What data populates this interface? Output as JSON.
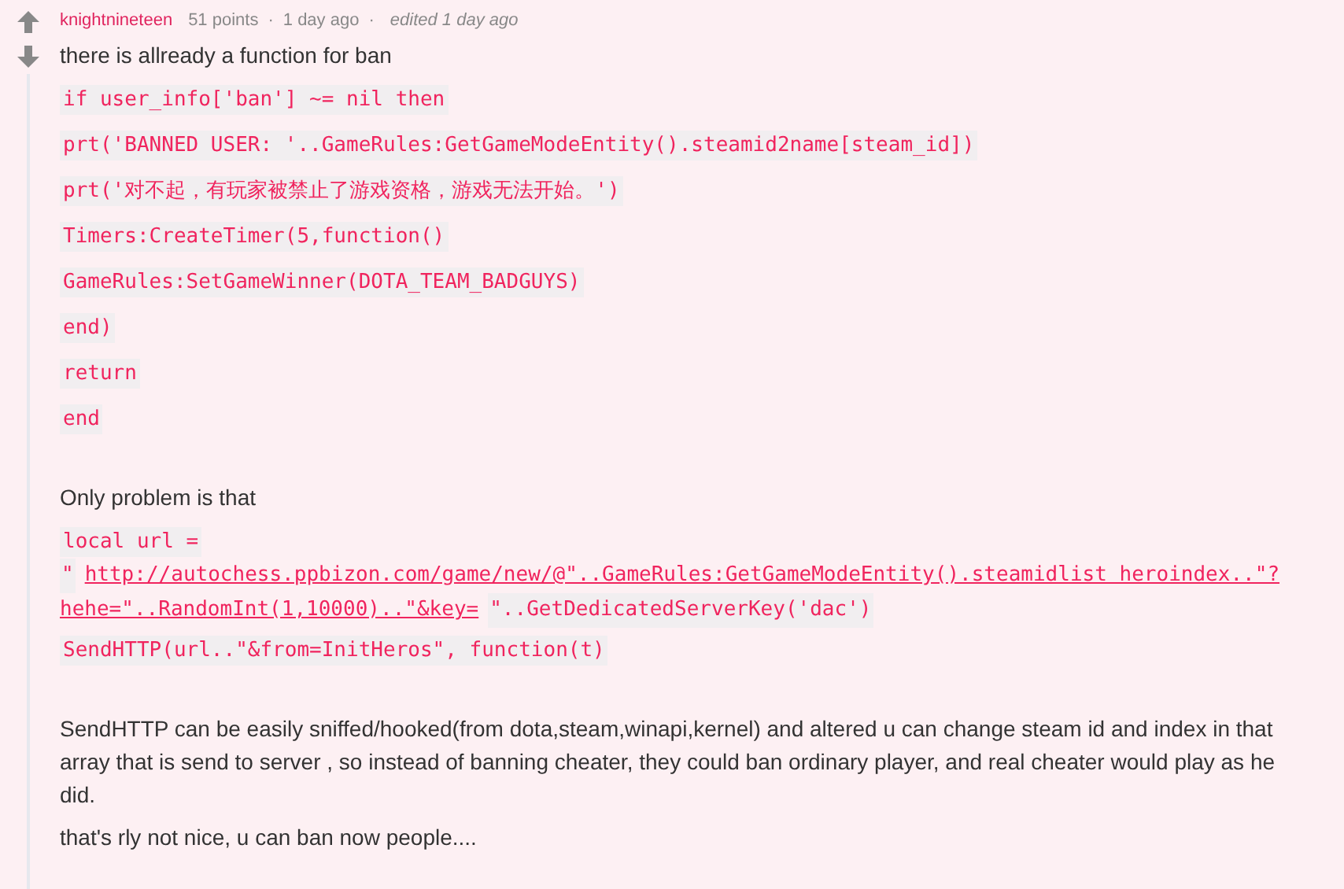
{
  "comment": {
    "author": "knightnineteen",
    "points": "51 points",
    "separator_1": "·",
    "time": "1 day ago",
    "separator_2": "·",
    "edited": "edited 1 day ago"
  },
  "blocks": [
    {
      "kind": "text",
      "text": "there is allready a function for ban"
    },
    {
      "kind": "code",
      "text": "if user_info['ban'] ~= nil then"
    },
    {
      "kind": "code",
      "text": "prt('BANNED USER: '..GameRules:GetGameModeEntity().steamid2name[steam_id])"
    },
    {
      "kind": "code",
      "text": "prt('对不起，有玩家被禁止了游戏资格，游戏无法开始。')"
    },
    {
      "kind": "code",
      "text": "Timers:CreateTimer(5,function()"
    },
    {
      "kind": "code",
      "text": "GameRules:SetGameWinner(DOTA_TEAM_BADGUYS)"
    },
    {
      "kind": "code",
      "text": "end)"
    },
    {
      "kind": "code",
      "text": "return"
    },
    {
      "kind": "code",
      "text": "end"
    },
    {
      "kind": "gap"
    },
    {
      "kind": "text",
      "text": "Only problem is that"
    },
    {
      "kind": "code",
      "text": "local url ="
    },
    {
      "kind": "mixed",
      "lines": [
        [
          {
            "kind": "code",
            "text": "\""
          },
          {
            "kind": "link",
            "text": "http://autochess.ppbizon.com/game/new/@\"..GameRules:GetGameModeEntity().steamidlist heroindex..\"?"
          }
        ],
        [
          {
            "kind": "link",
            "text": "hehe=\"..RandomInt(1,10000)..\"&key="
          },
          {
            "kind": "code",
            "text": "\"..GetDedicatedServerKey('dac')"
          }
        ]
      ]
    },
    {
      "kind": "code",
      "text": "SendHTTP(url..\"&from=InitHeros\", function(t)"
    },
    {
      "kind": "gap"
    },
    {
      "kind": "text",
      "text": "SendHTTP can be easily sniffed/hooked(from dota,steam,winapi,kernel) and altered u can change steam id and index in that array that is send to server , so instead of banning cheater, they could ban ordinary player, and real cheater would play as he did."
    },
    {
      "kind": "text",
      "text": "that's rly not nice, u can ban now people...."
    }
  ]
}
